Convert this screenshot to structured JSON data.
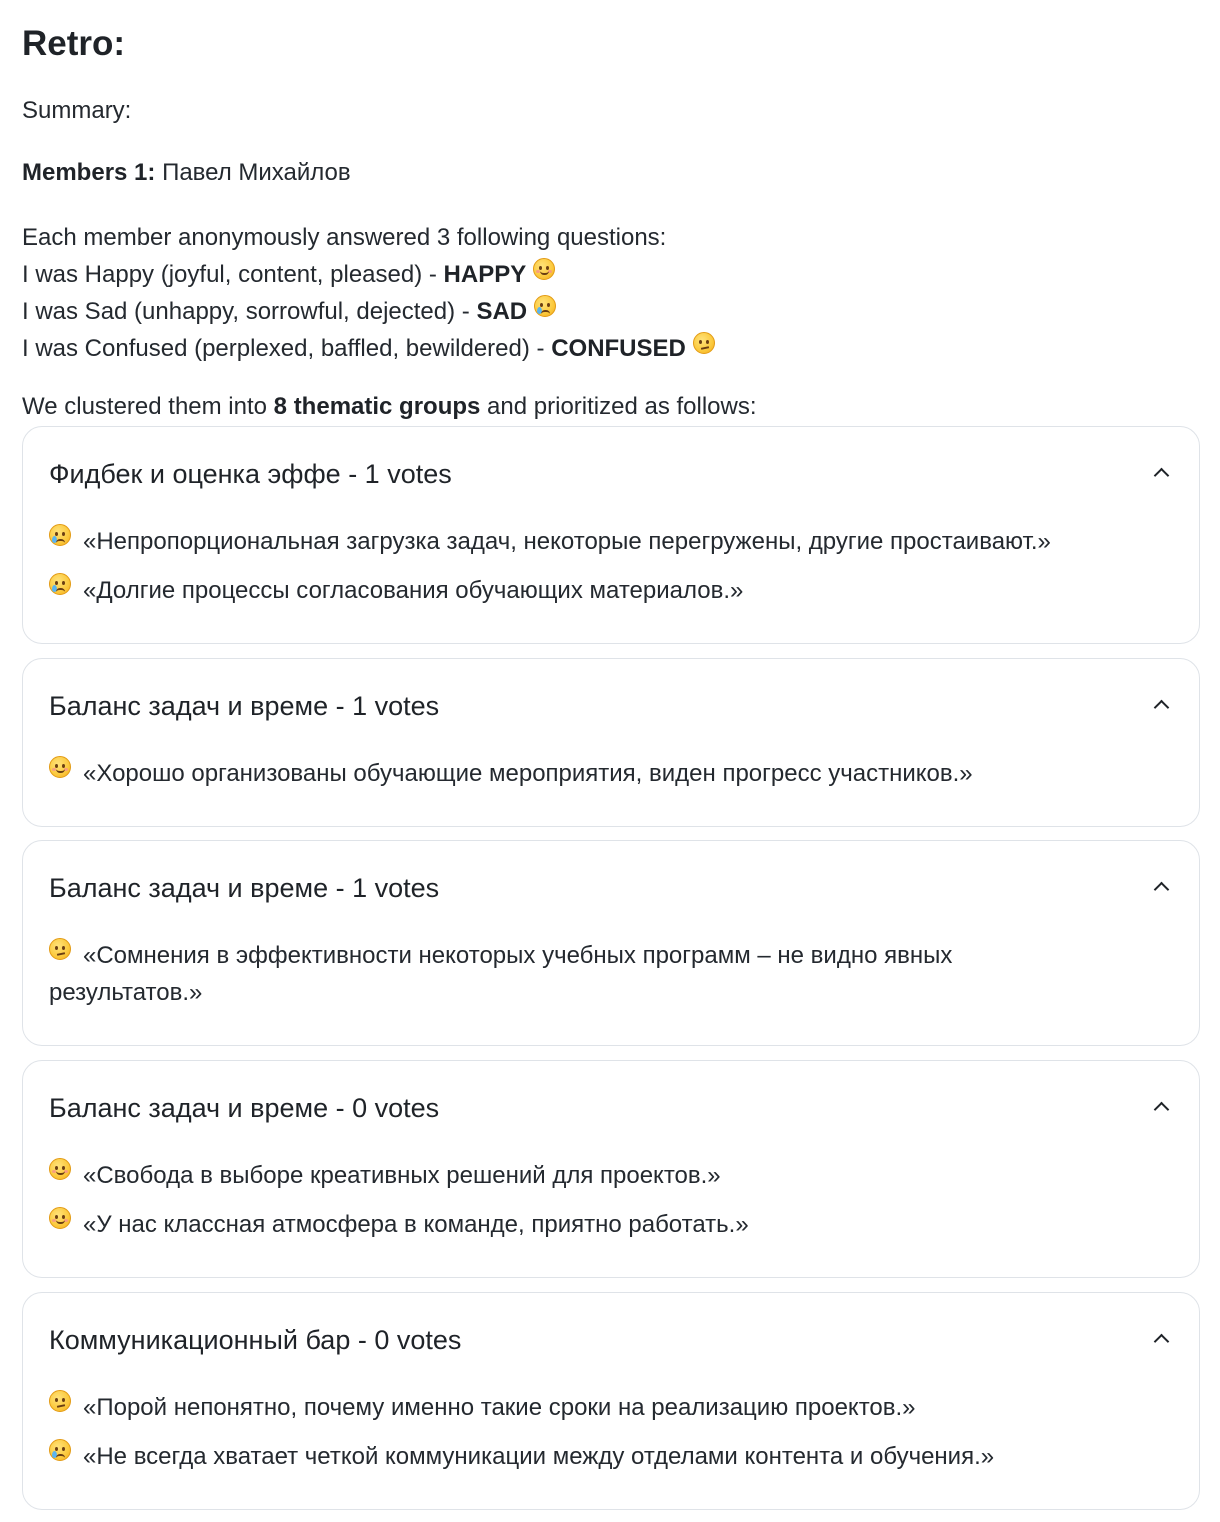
{
  "title": "Retro:",
  "summary_label": "Summary:",
  "members": {
    "label": "Members 1:",
    "names": "Павел Михайлов"
  },
  "intro": {
    "line1": "Each member anonymously answered 3 following questions:",
    "happy_text": "I was Happy (joyful, content, pleased) - ",
    "happy_tag": "HAPPY",
    "sad_text": "I was Sad (unhappy, sorrowful, dejected) - ",
    "sad_tag": "SAD",
    "confused_text": "I was Confused (perplexed, baffled, bewildered) - ",
    "confused_tag": "CONFUSED"
  },
  "clustered": {
    "before": "We clustered them into ",
    "bold": "8 thematic groups",
    "after": " and prioritized as follows:"
  },
  "groups": [
    {
      "title": "Фидбек и оценка эффе - 1 votes",
      "items": [
        {
          "mood": "sad",
          "text": "«Непропорциональная загрузка задач, некоторые перегружены, другие простаивают.»"
        },
        {
          "mood": "sad",
          "text": "«Долгие процессы согласования обучающих материалов.»"
        }
      ]
    },
    {
      "title": "Баланс задач и време - 1 votes",
      "items": [
        {
          "mood": "happy",
          "text": "«Хорошо организованы обучающие мероприятия, виден прогресс участников.»"
        }
      ]
    },
    {
      "title": "Баланс задач и време - 1 votes",
      "items": [
        {
          "mood": "confused",
          "text": "«Сомнения в эффективности некоторых учебных программ – не видно явных результатов.»"
        }
      ]
    },
    {
      "title": "Баланс задач и време - 0 votes",
      "items": [
        {
          "mood": "happy",
          "text": "«Свобода в выборе креативных решений для проектов.»"
        },
        {
          "mood": "happy",
          "text": "«У нас классная атмосфера в команде, приятно работать.»"
        }
      ]
    },
    {
      "title": "Коммуникационный бар - 0 votes",
      "items": [
        {
          "mood": "confused",
          "text": "«Порой непонятно, почему именно такие сроки на реализацию проектов.»"
        },
        {
          "mood": "sad",
          "text": "«Не всегда хватает четкой коммуникации между отделами контента и обучения.»"
        }
      ]
    }
  ]
}
